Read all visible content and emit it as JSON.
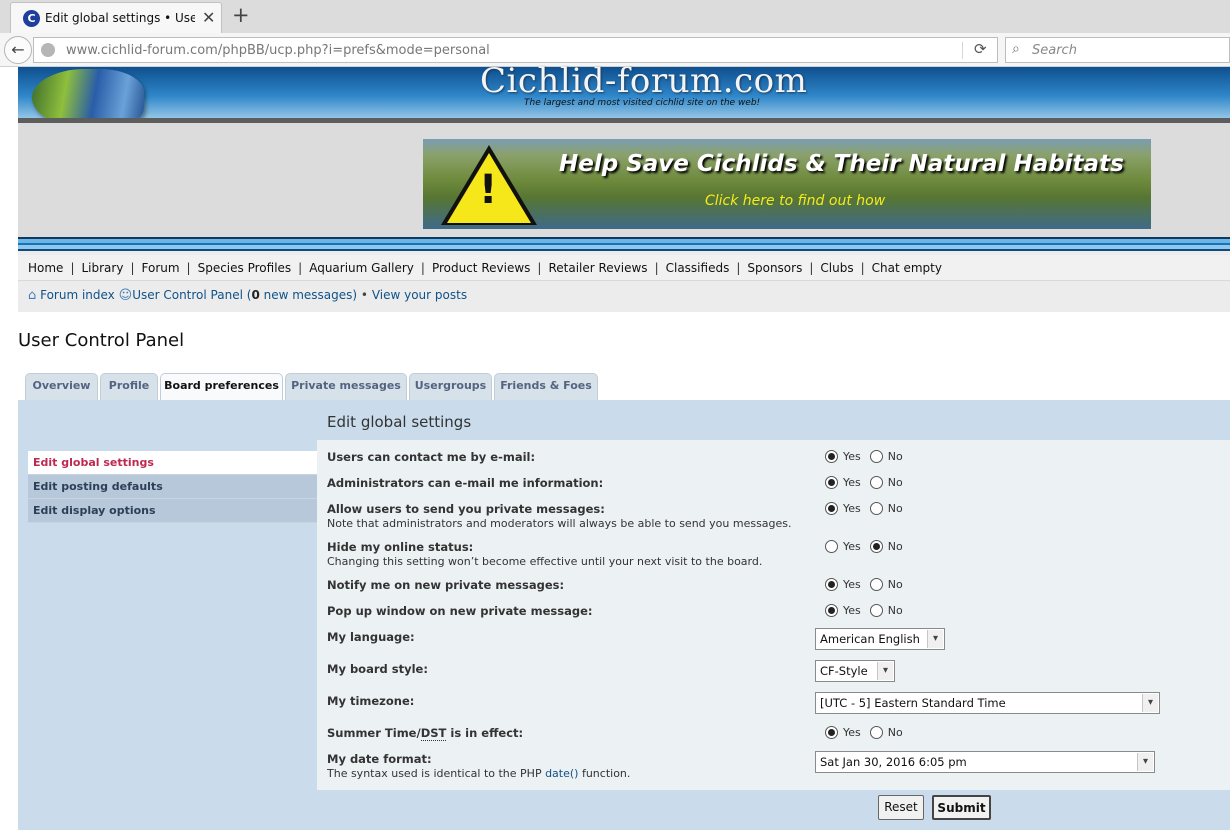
{
  "browser": {
    "tab_title": "Edit global settings • User ...",
    "favicon_letter": "C",
    "close_glyph": "✕",
    "new_tab_glyph": "+",
    "url": "www.cichlid-forum.com/phpBB/ucp.php?i=prefs&mode=personal",
    "search_placeholder": "Search"
  },
  "site": {
    "title": "Cichlid-forum.com",
    "tagline": "The largest and most visited cichlid site on the web!",
    "banner": {
      "headline": "Help Save Cichlids & Their Natural Habitats",
      "subline": "Click here to find out how",
      "mark": "!"
    }
  },
  "nav": {
    "links": [
      "Home",
      "Library",
      "Forum",
      "Species Profiles",
      "Aquarium Gallery",
      "Product Reviews",
      "Retailer Reviews",
      "Classifieds",
      "Sponsors",
      "Clubs",
      "Chat empty"
    ],
    "separator": "|"
  },
  "breadcrumbs": {
    "forum_index": "Forum index",
    "ucp": "User Control Panel",
    "messages_open": "(",
    "messages_count": "0",
    "messages_text": " new messages)",
    "bullet": " • ",
    "view_posts": "View your posts"
  },
  "page_title": "User Control Panel",
  "tabs": [
    {
      "label": "Overview",
      "active": false
    },
    {
      "label": "Profile",
      "active": false
    },
    {
      "label": "Board preferences",
      "active": true
    },
    {
      "label": "Private messages",
      "active": false
    },
    {
      "label": "Usergroups",
      "active": false
    },
    {
      "label": "Friends & Foes",
      "active": false
    }
  ],
  "sidemenu": [
    {
      "label": "Edit global settings",
      "active": true
    },
    {
      "label": "Edit posting defaults",
      "active": false
    },
    {
      "label": "Edit display options",
      "active": false
    }
  ],
  "panel_title": "Edit global settings",
  "options": {
    "yes": "Yes",
    "no": "No"
  },
  "settings": {
    "contact_email": {
      "label": "Users can contact me by e-mail:",
      "value": "Yes"
    },
    "admin_email": {
      "label": "Administrators can e-mail me information:",
      "value": "Yes"
    },
    "allow_pm": {
      "label": "Allow users to send you private messages:",
      "explain": "Note that administrators and moderators will always be able to send you messages.",
      "value": "Yes"
    },
    "hide_online": {
      "label": "Hide my online status:",
      "explain": "Changing this setting won’t become effective until your next visit to the board.",
      "value": "No"
    },
    "notify_pm": {
      "label": "Notify me on new private messages:",
      "value": "Yes"
    },
    "popup_pm": {
      "label": "Pop up window on new private message:",
      "value": "Yes"
    },
    "language": {
      "label": "My language:",
      "value": "American English"
    },
    "style": {
      "label": "My board style:",
      "value": "CF-Style"
    },
    "timezone": {
      "label": "My timezone:",
      "value": "[UTC - 5] Eastern Standard Time"
    },
    "dst": {
      "label_prefix": "Summer Time/",
      "label_abbr": "DST",
      "label_suffix": " is in effect:",
      "value": "Yes"
    },
    "date_format": {
      "label": "My date format:",
      "explain_prefix": "The syntax used is identical to the PHP ",
      "explain_link": "date()",
      "explain_suffix": " function.",
      "value": "Sat Jan 30, 2016 6:05 pm"
    }
  },
  "buttons": {
    "reset": "Reset",
    "submit": "Submit"
  },
  "colors": {
    "panel_bg": "#cadceb",
    "form_bg": "#ecf1f3",
    "active_menu_text": "#bc2a4d",
    "link": "#105289"
  },
  "icons": {
    "back": "back-arrow-icon",
    "reload": "reload-icon",
    "search": "search-icon",
    "home": "home-icon",
    "user": "user-icon",
    "select": "chevron-down-icon"
  }
}
